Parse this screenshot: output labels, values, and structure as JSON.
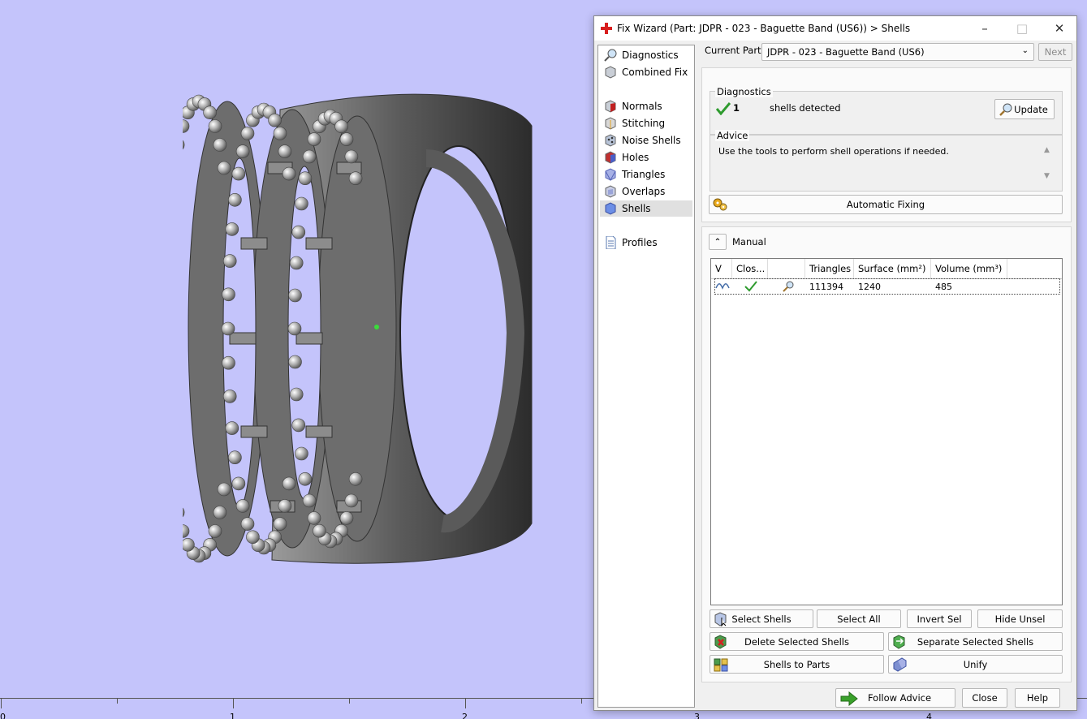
{
  "ruler": {
    "labels": [
      "0",
      "1",
      "2",
      "3",
      "4"
    ]
  },
  "dialog": {
    "title": "Fix Wizard (Part: JDPR - 023 - Baguette Band (US6)) > Shells",
    "nav": {
      "diagnostics": "Diagnostics",
      "combined_fix": "Combined Fix",
      "normals": "Normals",
      "stitching": "Stitching",
      "noise_shells": "Noise Shells",
      "holes": "Holes",
      "triangles": "Triangles",
      "overlaps": "Overlaps",
      "shells": "Shells",
      "profiles": "Profiles"
    },
    "current_part_label": "Current Part:",
    "current_part_value": "JDPR - 023 - Baguette Band (US6)",
    "next_button": "Next",
    "diagnostics": {
      "heading": "Diagnostics",
      "count": "1",
      "text": "shells detected",
      "update_button": "Update"
    },
    "advice": {
      "heading": "Advice",
      "text": "Use the tools to perform shell operations if needed."
    },
    "automatic_fixing_button": "Automatic Fixing",
    "manual_label": "Manual",
    "table": {
      "columns": [
        "V",
        "Clos...",
        "",
        "Triangles",
        "Surface (mm²)",
        "Volume (mm³)"
      ],
      "rows": [
        {
          "triangles": "111394",
          "surface": "1240",
          "volume": "485"
        }
      ]
    },
    "buttons": {
      "select_shells": "Select Shells",
      "select_all": "Select All",
      "invert_sel": "Invert Sel",
      "hide_unsel": "Hide Unsel",
      "delete_selected": "Delete Selected Shells",
      "separate_selected": "Separate Selected Shells",
      "shells_to_parts": "Shells to Parts",
      "unify": "Unify",
      "follow_advice": "Follow Advice",
      "close": "Close",
      "help": "Help"
    }
  },
  "colors": {
    "viewport_bg": "#c4c4fb",
    "check_green": "#2e9b2e",
    "arrow_green": "#3aa12b"
  }
}
